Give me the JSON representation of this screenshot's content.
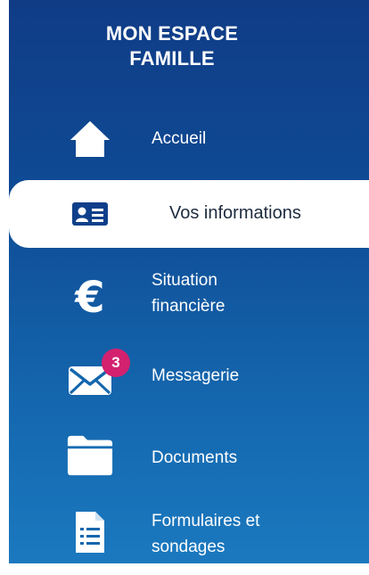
{
  "sidebar": {
    "title": "MON ESPACE\nFAMILLE",
    "items": [
      {
        "label": "Accueil",
        "icon": "home-icon",
        "active": false
      },
      {
        "label": "Vos informations",
        "icon": "id-card-icon",
        "active": true
      },
      {
        "label": "Situation\nfinancière",
        "icon": "euro-icon",
        "active": false
      },
      {
        "label": "Messagerie",
        "icon": "mail-icon",
        "active": false,
        "badge": "3"
      },
      {
        "label": "Documents",
        "icon": "folder-icon",
        "active": false
      },
      {
        "label": "Formulaires et\nsondages",
        "icon": "form-icon",
        "active": false
      }
    ]
  },
  "colors": {
    "sidebar_top": "#103c86",
    "sidebar_bottom": "#1b79bf",
    "active_bg": "#ffffff",
    "active_text": "#1d2b3f",
    "badge": "#d3216f"
  }
}
